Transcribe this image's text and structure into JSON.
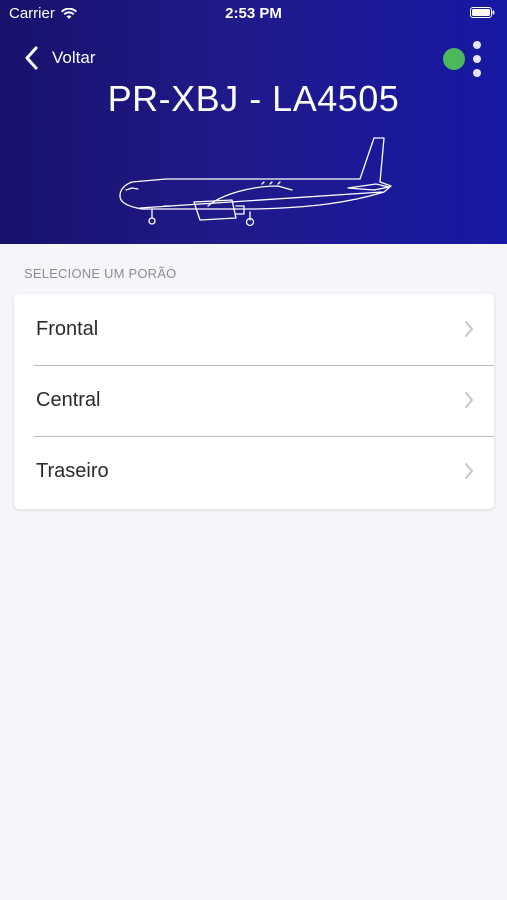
{
  "status_bar": {
    "carrier": "Carrier",
    "time": "2:53 PM"
  },
  "nav": {
    "back_label": "Voltar",
    "connection_status_color": "#4cb85c"
  },
  "flight": {
    "title": "PR-XBJ - LA4505"
  },
  "holds": {
    "section_label": "SELECIONE UM PORÃO",
    "items": [
      {
        "label": "Frontal"
      },
      {
        "label": "Central"
      },
      {
        "label": "Traseiro"
      }
    ]
  },
  "colors": {
    "header_start": "#17126b",
    "header_end": "#1718a3",
    "background": "#f4f6f9",
    "status_ok": "#4cb85c"
  },
  "icons": [
    "wifi-icon",
    "battery-icon",
    "chevron-left-icon",
    "more-vertical-icon",
    "aircraft-illustration",
    "chevron-right-icon"
  ]
}
